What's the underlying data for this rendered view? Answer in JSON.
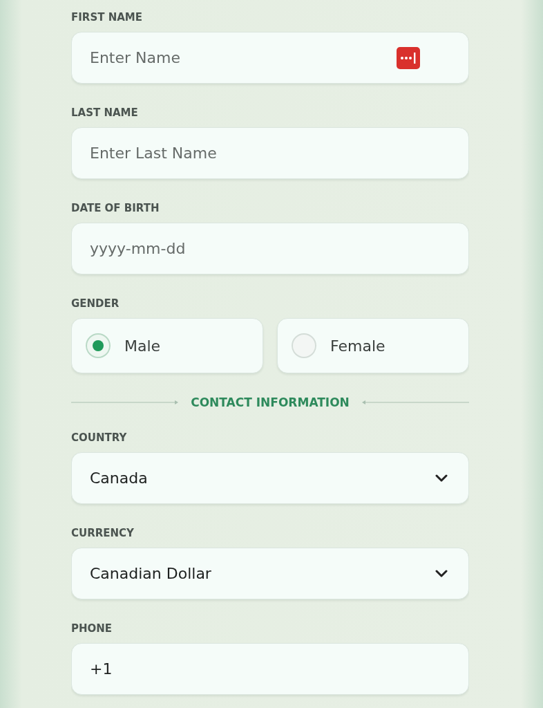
{
  "personal": [
    {
      "kind": "text",
      "label": "FIRST NAME",
      "placeholder": "Enter Name",
      "autofill_icon": true
    },
    {
      "kind": "text",
      "label": "LAST NAME",
      "placeholder": "Enter Last Name",
      "autofill_icon": false
    },
    {
      "kind": "text",
      "label": "DATE OF BIRTH",
      "placeholder": "yyyy-mm-dd",
      "autofill_icon": false
    }
  ],
  "gender": {
    "label": "GENDER",
    "options": [
      {
        "label": "Male",
        "selected": true
      },
      {
        "label": "Female",
        "selected": false
      }
    ]
  },
  "contact_heading": "CONTACT INFORMATION",
  "contact": [
    {
      "kind": "select",
      "label": "COUNTRY",
      "value": "Canada"
    },
    {
      "kind": "select",
      "label": "CURRENCY",
      "value": "Canadian Dollar"
    },
    {
      "kind": "text",
      "label": "PHONE",
      "value": "+1",
      "autofill_icon": false
    }
  ]
}
